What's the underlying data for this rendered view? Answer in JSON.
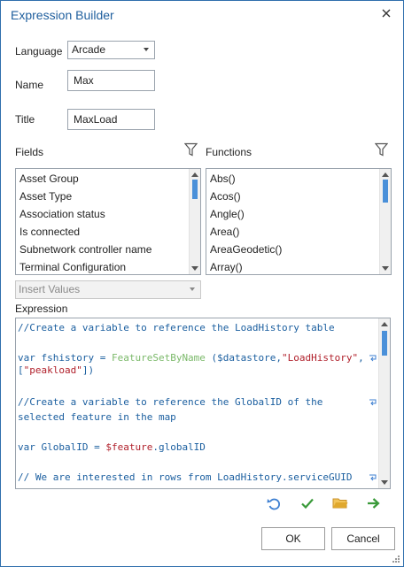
{
  "dialog": {
    "title": "Expression Builder"
  },
  "form": {
    "language_label": "Language",
    "language_value": "Arcade",
    "name_label": "Name",
    "name_value": "Max",
    "title_label": "Title",
    "title_value": "MaxLoad"
  },
  "fields": {
    "label": "Fields",
    "items": [
      "Asset Group",
      "Asset Type",
      "Association status",
      "Is connected",
      "Subnetwork controller name",
      "Terminal Configuration"
    ]
  },
  "functions": {
    "label": "Functions",
    "items": [
      "Abs()",
      "Acos()",
      "Angle()",
      "Area()",
      "AreaGeodetic()",
      "Array()"
    ]
  },
  "insert_values": {
    "label": "Insert Values"
  },
  "expression": {
    "label": "Expression",
    "lines": {
      "l1": "//Create a variable to reference the LoadHistory table",
      "l3a": "var fshistory = ",
      "l3b": "FeatureSetByName",
      "l3c": " ($datastore,",
      "l3d": "\"LoadHistory\"",
      "l3e": ",",
      "l4a": "[",
      "l4b": "\"peakload\"",
      "l4c": "])",
      "l6": "//Create a variable to reference the GlobalID of the",
      "l7": "selected feature in the map",
      "l9a": "var GlobalID = ",
      "l9b": "$feature",
      "l9c": ".globalID",
      "l11": "// We are interested in rows from LoadHistory.serviceGUID"
    }
  },
  "buttons": {
    "ok": "OK",
    "cancel": "Cancel"
  },
  "icons": [
    "close-icon",
    "filter-icon",
    "undo-icon",
    "check-icon",
    "folder-icon",
    "run-icon",
    "wrap-icon"
  ],
  "colors": {
    "accent": "#2f6fad",
    "check": "#3a9a3a",
    "folder": "#e0a82e",
    "scroll_thumb": "#4a90d9"
  }
}
